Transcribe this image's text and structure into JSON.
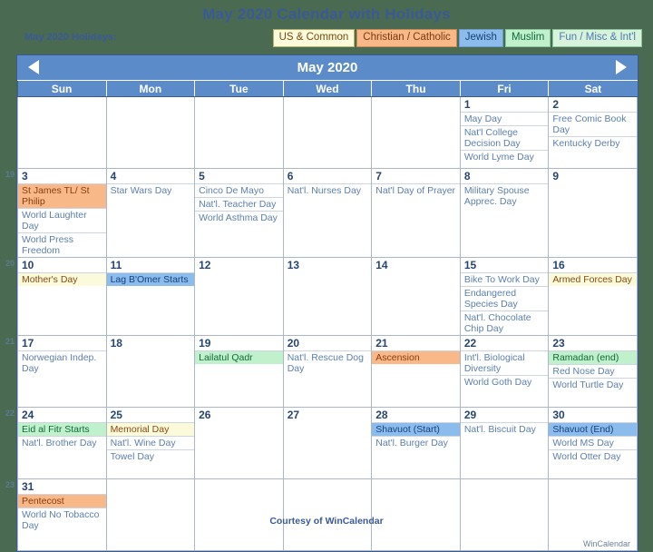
{
  "page": {
    "title": "May 2020 Calendar with Holidays",
    "background_color": "#4a6b52",
    "title_color": "#3a5a96"
  },
  "legend": {
    "label": "May 2020 Holidays:",
    "chips": [
      {
        "label": "US & Common",
        "key": "us",
        "bg": "#fbfada"
      },
      {
        "label": "Christian / Catholic",
        "key": "christ",
        "bg": "#f8b887"
      },
      {
        "label": "Jewish",
        "key": "jewish",
        "bg": "#8cbcec"
      },
      {
        "label": "Muslim",
        "key": "muslim",
        "bg": "#c0f0cc"
      },
      {
        "label": "Fun / Misc & Int'l",
        "key": "fun",
        "bg": "#d8f2dc"
      }
    ]
  },
  "nav": {
    "month_title": "May 2020",
    "prev_icon": "triangle-left-icon",
    "next_icon": "triangle-right-icon"
  },
  "weekday_headers": [
    "Sun",
    "Mon",
    "Tue",
    "Wed",
    "Thu",
    "Fri",
    "Sat"
  ],
  "week_numbers": [
    "19",
    "20",
    "21",
    "22",
    "23"
  ],
  "weeks": [
    {
      "number": "",
      "days": [
        {
          "num": "",
          "blank": true,
          "events": []
        },
        {
          "num": "",
          "blank": true,
          "events": []
        },
        {
          "num": "",
          "blank": true,
          "events": []
        },
        {
          "num": "",
          "blank": true,
          "events": []
        },
        {
          "num": "",
          "blank": true,
          "events": []
        },
        {
          "num": "1",
          "events": [
            {
              "text": "May Day",
              "key": "fun"
            },
            {
              "text": "Nat'l College Decision Day",
              "key": "fun"
            },
            {
              "text": "World Lyme Day",
              "key": "fun"
            }
          ]
        },
        {
          "num": "2",
          "weekend": true,
          "events": [
            {
              "text": "Free Comic Book Day",
              "key": "fun"
            },
            {
              "text": "Kentucky Derby",
              "key": "fun"
            }
          ]
        }
      ]
    },
    {
      "number": "19",
      "days": [
        {
          "num": "3",
          "weekend": true,
          "events": [
            {
              "text": "St James TL/ St Philip",
              "key": "christ"
            },
            {
              "text": "World Laughter Day",
              "key": "fun"
            },
            {
              "text": "World Press Freedom",
              "key": "fun"
            }
          ]
        },
        {
          "num": "4",
          "events": [
            {
              "text": "Star Wars Day",
              "key": "fun"
            }
          ]
        },
        {
          "num": "5",
          "events": [
            {
              "text": "Cinco De Mayo",
              "key": "fun"
            },
            {
              "text": "Nat'l. Teacher Day",
              "key": "fun"
            },
            {
              "text": "World Asthma Day",
              "key": "fun"
            }
          ]
        },
        {
          "num": "6",
          "events": [
            {
              "text": "Nat'l. Nurses Day",
              "key": "fun"
            }
          ]
        },
        {
          "num": "7",
          "events": [
            {
              "text": "Nat'l Day of Prayer",
              "key": "fun"
            }
          ]
        },
        {
          "num": "8",
          "events": [
            {
              "text": "Military Spouse Apprec. Day",
              "key": "fun"
            }
          ]
        },
        {
          "num": "9",
          "weekend": true,
          "events": []
        }
      ]
    },
    {
      "number": "20",
      "days": [
        {
          "num": "10",
          "weekend": true,
          "events": [
            {
              "text": "Mother's Day",
              "key": "us"
            }
          ]
        },
        {
          "num": "11",
          "events": [
            {
              "text": "Lag B'Omer Starts",
              "key": "jewish"
            }
          ]
        },
        {
          "num": "12",
          "events": []
        },
        {
          "num": "13",
          "events": []
        },
        {
          "num": "14",
          "events": []
        },
        {
          "num": "15",
          "events": [
            {
              "text": "Bike To Work Day",
              "key": "fun"
            },
            {
              "text": "Endangered Species Day",
              "key": "fun"
            },
            {
              "text": "Nat'l. Chocolate Chip Day",
              "key": "fun"
            }
          ]
        },
        {
          "num": "16",
          "weekend": true,
          "events": [
            {
              "text": "Armed Forces Day",
              "key": "us"
            }
          ]
        }
      ]
    },
    {
      "number": "21",
      "days": [
        {
          "num": "17",
          "weekend": true,
          "events": [
            {
              "text": "Norwegian Indep. Day",
              "key": "fun"
            }
          ]
        },
        {
          "num": "18",
          "events": []
        },
        {
          "num": "19",
          "events": [
            {
              "text": "Lailatul Qadr",
              "key": "muslim"
            }
          ]
        },
        {
          "num": "20",
          "events": [
            {
              "text": "Nat'l. Rescue Dog Day",
              "key": "fun"
            }
          ]
        },
        {
          "num": "21",
          "events": [
            {
              "text": "Ascension",
              "key": "christ"
            }
          ]
        },
        {
          "num": "22",
          "events": [
            {
              "text": "Int'l. Biological Diversity",
              "key": "fun"
            },
            {
              "text": "World Goth Day",
              "key": "fun"
            }
          ]
        },
        {
          "num": "23",
          "weekend": true,
          "events": [
            {
              "text": "Ramadan (end)",
              "key": "muslim"
            },
            {
              "text": "Red Nose Day",
              "key": "fun"
            },
            {
              "text": "World Turtle Day",
              "key": "fun"
            }
          ]
        }
      ]
    },
    {
      "number": "22",
      "days": [
        {
          "num": "24",
          "weekend": true,
          "events": [
            {
              "text": "Eid al Fitr Starts",
              "key": "muslim"
            },
            {
              "text": "Nat'l. Brother Day",
              "key": "fun"
            }
          ]
        },
        {
          "num": "25",
          "events": [
            {
              "text": "Memorial Day",
              "key": "us"
            },
            {
              "text": "Nat'l. Wine Day",
              "key": "fun"
            },
            {
              "text": "Towel Day",
              "key": "fun"
            }
          ]
        },
        {
          "num": "26",
          "events": []
        },
        {
          "num": "27",
          "events": []
        },
        {
          "num": "28",
          "events": [
            {
              "text": "Shavuot (Start)",
              "key": "jewish"
            },
            {
              "text": "Nat'l. Burger Day",
              "key": "fun"
            }
          ]
        },
        {
          "num": "29",
          "events": [
            {
              "text": "Nat'l. Biscuit Day",
              "key": "fun"
            }
          ]
        },
        {
          "num": "30",
          "weekend": true,
          "events": [
            {
              "text": "Shavuot (End)",
              "key": "jewish"
            },
            {
              "text": "World MS Day",
              "key": "fun"
            },
            {
              "text": "World Otter Day",
              "key": "fun"
            }
          ]
        }
      ]
    },
    {
      "number": "23",
      "days": [
        {
          "num": "31",
          "weekend": true,
          "events": [
            {
              "text": "Pentecost",
              "key": "christ"
            },
            {
              "text": "World No Tobacco Day",
              "key": "fun"
            }
          ]
        },
        {
          "num": "",
          "blank": true,
          "events": []
        },
        {
          "num": "",
          "blank": true,
          "events": []
        },
        {
          "num": "",
          "blank": true,
          "events": []
        },
        {
          "num": "",
          "blank": true,
          "events": []
        },
        {
          "num": "",
          "blank": true,
          "events": []
        },
        {
          "num": "",
          "blank": true,
          "events": []
        }
      ]
    }
  ],
  "footer": {
    "brand": "WinCalendar",
    "courtesy_prefix": "Courtesy of ",
    "courtesy_brand": "WinCalendar"
  }
}
